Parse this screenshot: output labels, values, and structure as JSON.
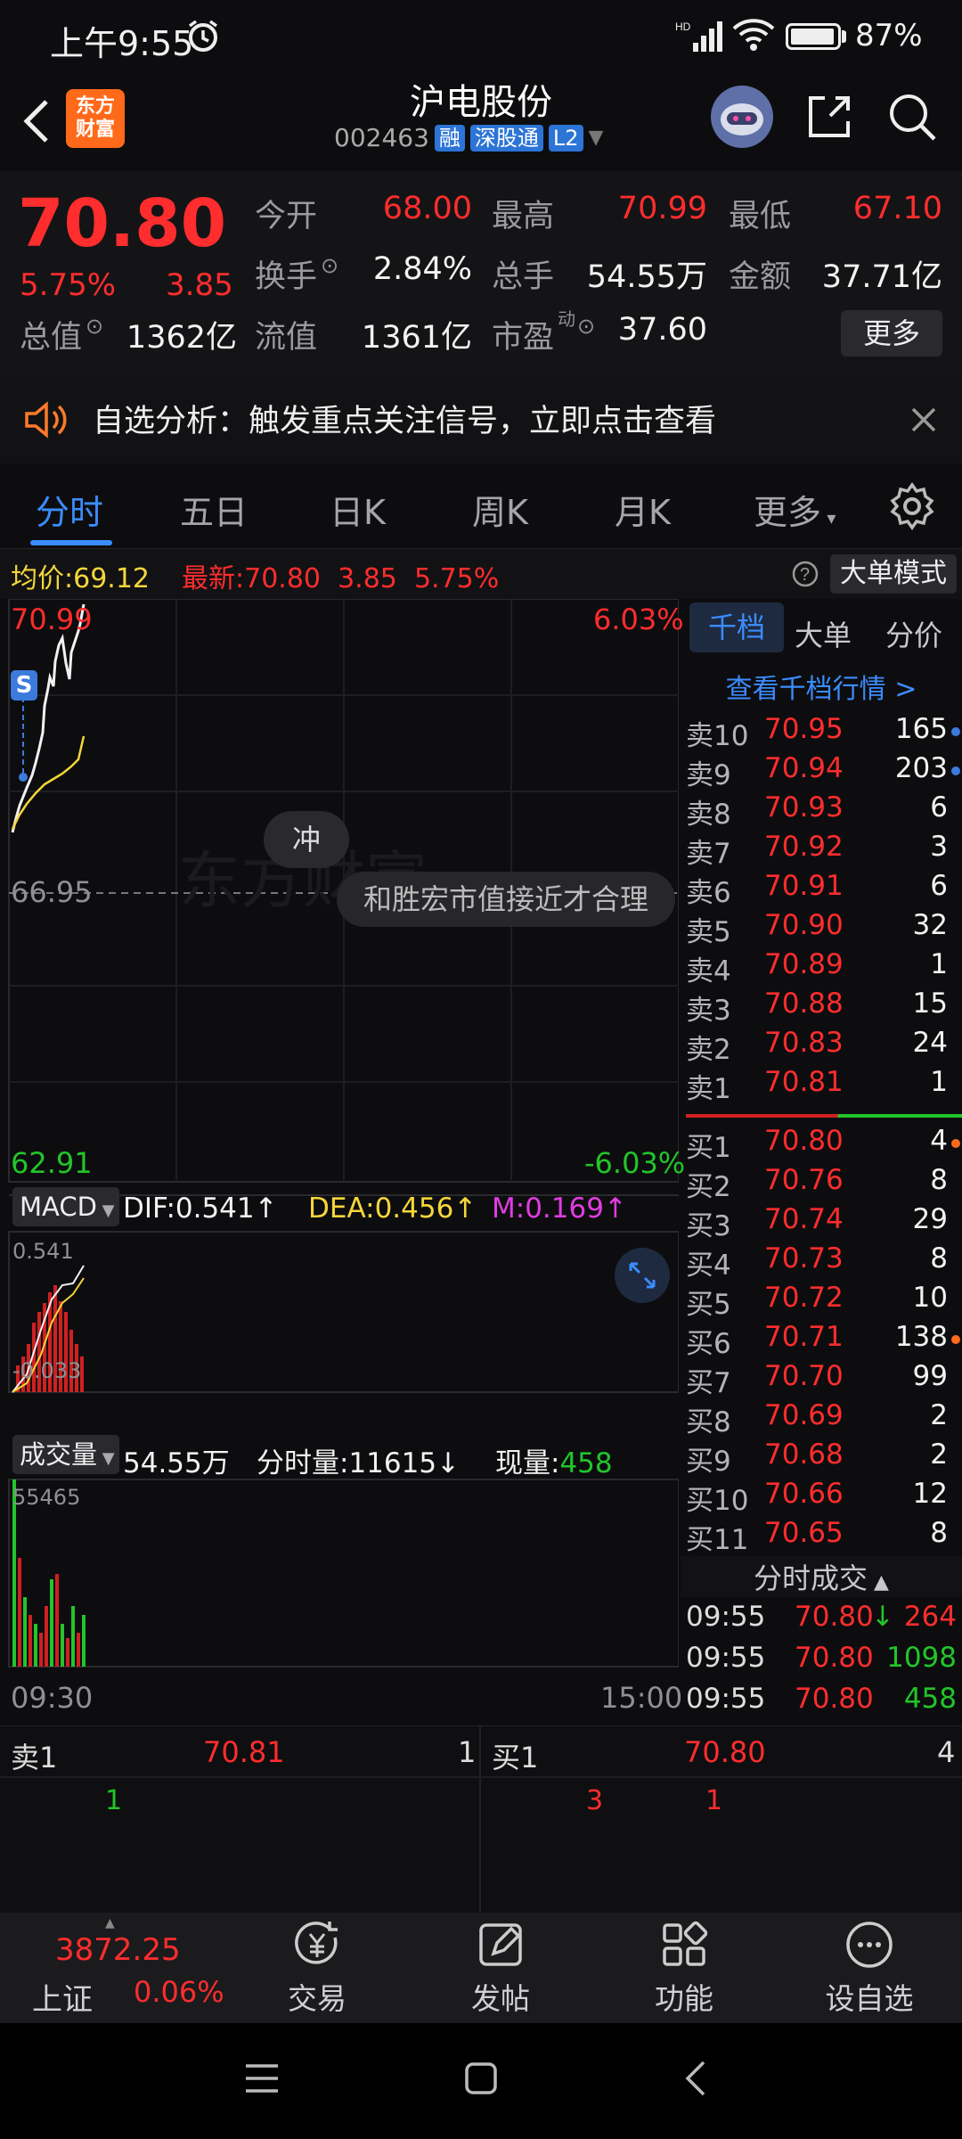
{
  "status_bar": {
    "time": "上午9:55",
    "battery": "87%",
    "network": "HD"
  },
  "header": {
    "title": "沪电股份",
    "code": "002463",
    "tags": [
      "融",
      "深股通",
      "L2"
    ],
    "logo_text_1": "东方",
    "logo_text_2": "财富"
  },
  "quote": {
    "price": "70.80",
    "change_pct": "5.75%",
    "change": "3.85",
    "open_label": "今开",
    "open": "68.00",
    "high_label": "最高",
    "high": "70.99",
    "low_label": "最低",
    "low": "67.10",
    "turnover_label": "换手",
    "turnover": "2.84%",
    "volume_label": "总手",
    "volume": "54.55万",
    "amount_label": "金额",
    "amount": "37.71亿",
    "mktcap_label": "总值",
    "mktcap": "1362亿",
    "float_label": "流值",
    "float": "1361亿",
    "pe_label": "市盈",
    "pe_sup": "动",
    "pe": "37.60",
    "more_button": "更多"
  },
  "alert": {
    "text": "自选分析：触发重点关注信号，立即点击查看"
  },
  "tabs": [
    "分时",
    "五日",
    "日K",
    "周K",
    "月K",
    "更多"
  ],
  "avg_line": {
    "avg_label": "均价:",
    "avg": "69.12",
    "latest_label": "最新:",
    "latest": "70.80",
    "change": "3.85",
    "pct": "5.75%",
    "big_mode": "大单模式"
  },
  "chart": {
    "price_high": "70.99",
    "pct_high": "6.03%",
    "prev_close": "66.95",
    "price_low": "62.91",
    "pct_low": "-6.03%",
    "s_marker": "S",
    "chong_marker": "冲",
    "news_bubble": "和胜宏市值接近才合理",
    "time_start": "09:30",
    "time_end": "15:00"
  },
  "macd": {
    "button": "MACD",
    "dif": "DIF:0.541",
    "dea": "DEA:0.456",
    "m": "M:0.169",
    "top": "0.541",
    "bottom": "-0.033"
  },
  "volume": {
    "button": "成交量",
    "total": "54.55万",
    "minute_label": "分时量:11615",
    "now_label": "现量:",
    "now": "458",
    "top": "55465"
  },
  "book": {
    "tabs": [
      "千档",
      "大单",
      "分价"
    ],
    "link": "查看千档行情 >",
    "asks": [
      {
        "label": "卖10",
        "price": "70.95",
        "vol": "165",
        "dot": "#3b7bdc"
      },
      {
        "label": "卖9",
        "price": "70.94",
        "vol": "203",
        "dot": "#3b7bdc"
      },
      {
        "label": "卖8",
        "price": "70.93",
        "vol": "6",
        "dot": ""
      },
      {
        "label": "卖7",
        "price": "70.92",
        "vol": "3",
        "dot": ""
      },
      {
        "label": "卖6",
        "price": "70.91",
        "vol": "6",
        "dot": ""
      },
      {
        "label": "卖5",
        "price": "70.90",
        "vol": "32",
        "dot": ""
      },
      {
        "label": "卖4",
        "price": "70.89",
        "vol": "1",
        "dot": ""
      },
      {
        "label": "卖3",
        "price": "70.88",
        "vol": "15",
        "dot": ""
      },
      {
        "label": "卖2",
        "price": "70.83",
        "vol": "24",
        "dot": ""
      },
      {
        "label": "卖1",
        "price": "70.81",
        "vol": "1",
        "dot": ""
      }
    ],
    "bids": [
      {
        "label": "买1",
        "price": "70.80",
        "vol": "4",
        "dot": "#ff6a1a"
      },
      {
        "label": "买2",
        "price": "70.76",
        "vol": "8",
        "dot": ""
      },
      {
        "label": "买3",
        "price": "70.74",
        "vol": "29",
        "dot": ""
      },
      {
        "label": "买4",
        "price": "70.73",
        "vol": "8",
        "dot": ""
      },
      {
        "label": "买5",
        "price": "70.72",
        "vol": "10",
        "dot": ""
      },
      {
        "label": "买6",
        "price": "70.71",
        "vol": "138",
        "dot": "#ff6a1a"
      },
      {
        "label": "买7",
        "price": "70.70",
        "vol": "99",
        "dot": ""
      },
      {
        "label": "买8",
        "price": "70.69",
        "vol": "2",
        "dot": ""
      },
      {
        "label": "买9",
        "price": "70.68",
        "vol": "2",
        "dot": ""
      },
      {
        "label": "买10",
        "price": "70.66",
        "vol": "12",
        "dot": ""
      },
      {
        "label": "买11",
        "price": "70.65",
        "vol": "8",
        "dot": ""
      }
    ],
    "trades_header": "分时成交",
    "trades": [
      {
        "time": "09:55",
        "price": "70.80",
        "arrow": "↓",
        "vol": "264",
        "vol_color": "red"
      },
      {
        "time": "09:55",
        "price": "70.80",
        "arrow": "",
        "vol": "1098",
        "vol_color": "green"
      },
      {
        "time": "09:55",
        "price": "70.80",
        "arrow": "",
        "vol": "458",
        "vol_color": "green"
      }
    ]
  },
  "strip": {
    "sell_label": "卖1",
    "sell_price": "70.81",
    "sell_vol": "1",
    "buy_label": "买1",
    "buy_price": "70.80",
    "buy_vol": "4",
    "q1": "1",
    "q2": "3",
    "q3": "1"
  },
  "nav": {
    "index_value": "3872.25",
    "index_name": "上证",
    "index_pct": "0.06%",
    "items": [
      "交易",
      "发帖",
      "功能",
      "设自选"
    ]
  }
}
